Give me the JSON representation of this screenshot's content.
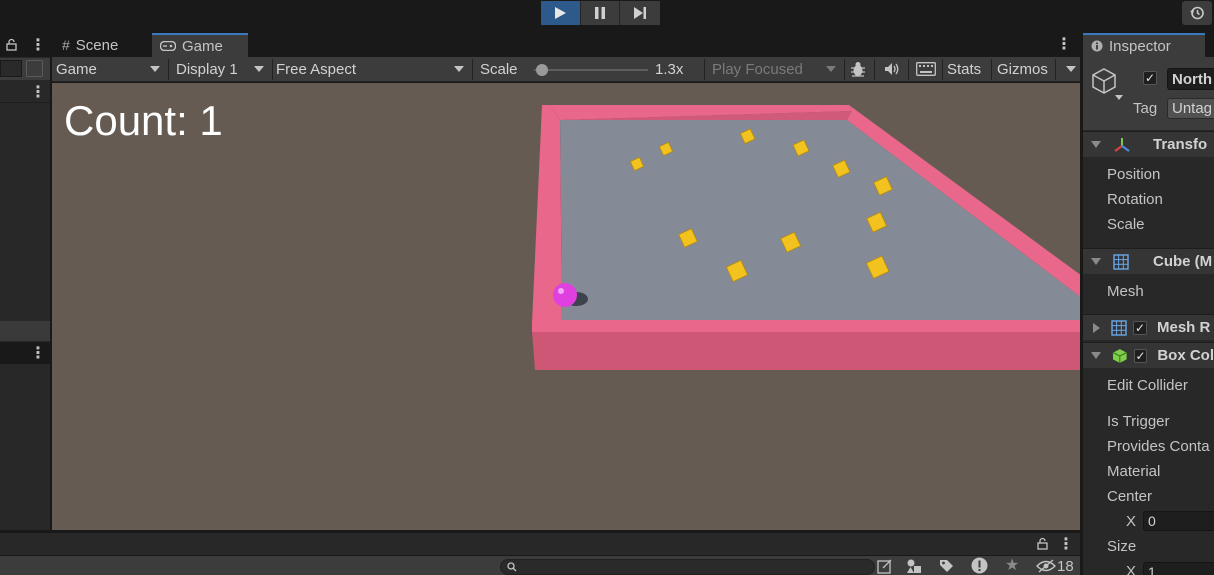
{
  "toolbar": {
    "play_icon": "play-icon",
    "pause_icon": "pause-icon",
    "step_icon": "step-icon",
    "history_icon": "history-icon"
  },
  "game_panel": {
    "tabs": [
      {
        "label": "Scene",
        "icon": "grid-icon"
      },
      {
        "label": "Game",
        "icon": "gamepad-icon",
        "active": true
      }
    ],
    "controls": {
      "game_dropdown": "Game",
      "display_dropdown": "Display 1",
      "aspect_dropdown": "Free Aspect",
      "scale_label": "Scale",
      "scale_value": "1.3x",
      "scale_fraction": 0.02,
      "play_focused": "Play Focused",
      "stats": "Stats",
      "gizmos": "Gizmos"
    },
    "hud": {
      "count_text": "Count: 1"
    }
  },
  "inspector": {
    "tab_label": "Inspector",
    "object_name": "North",
    "tag_label": "Tag",
    "tag_value": "Untag",
    "transform": {
      "header": "Transfo",
      "fields": [
        "Position",
        "Rotation",
        "Scale"
      ]
    },
    "cube": {
      "header": "Cube (M",
      "fields": [
        "Mesh"
      ]
    },
    "mesh_renderer": {
      "header": "Mesh R"
    },
    "box_collider": {
      "header": "Box Col",
      "fields": [
        "Edit Collider",
        "Is Trigger",
        "Provides Conta",
        "Material",
        "Center"
      ],
      "center_x_label": "X",
      "center_x_value": "0",
      "size_label": "Size",
      "size_x_label": "X",
      "size_x_value": "1"
    }
  },
  "bottom": {
    "hidden_count": "18"
  },
  "colors": {
    "accent": "#2d5a8a",
    "viewport_bg": "#655b53",
    "wall": "#e0607e",
    "floor": "#848a96",
    "pickup": "#f0c020",
    "player": "#e040e0"
  }
}
